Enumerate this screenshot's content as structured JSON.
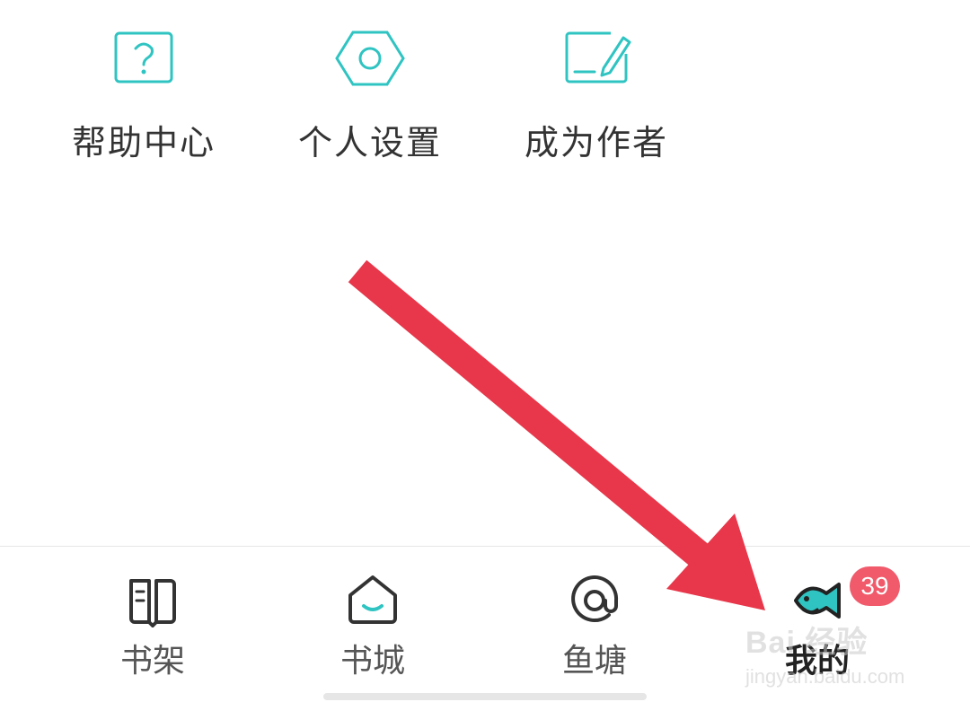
{
  "quick_actions": [
    {
      "label": "帮助中心",
      "icon": "help-question-icon"
    },
    {
      "label": "个人设置",
      "icon": "settings-hexagon-icon"
    },
    {
      "label": "成为作者",
      "icon": "write-author-icon"
    }
  ],
  "tabbar": {
    "tabs": [
      {
        "label": "书架",
        "icon": "bookshelf-icon",
        "active": false
      },
      {
        "label": "书城",
        "icon": "bookstore-home-icon",
        "active": false
      },
      {
        "label": "鱼塘",
        "icon": "fishpond-at-icon",
        "active": false
      },
      {
        "label": "我的",
        "icon": "profile-fish-icon",
        "active": true
      }
    ],
    "badge_count": "39"
  },
  "annotation": {
    "arrow_color": "#e8374a",
    "target": "我的"
  },
  "watermark": {
    "main": "Bai 经验",
    "url": "jingyan.baidu.com"
  },
  "colors": {
    "accent": "#2fc4c2",
    "badge": "#f05a6b",
    "icon_dark": "#333333"
  }
}
